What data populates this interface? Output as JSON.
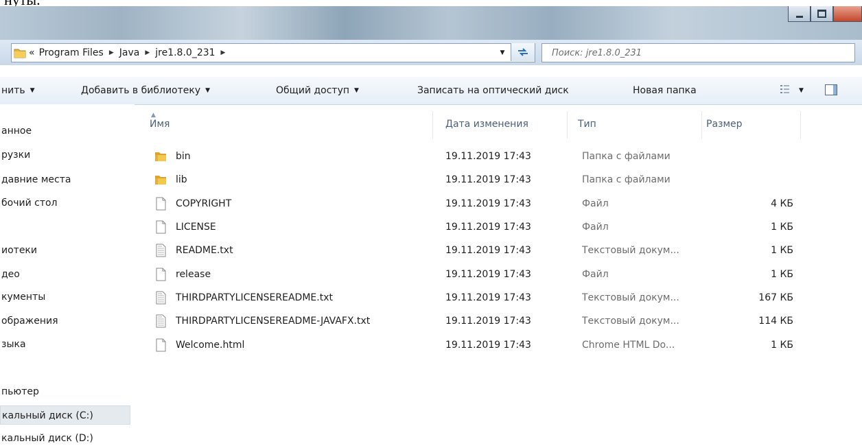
{
  "topstrip_text": "нуты.",
  "address": {
    "overflow": "«",
    "breadcrumbs": [
      "Program Files",
      "Java",
      "jre1.8.0_231"
    ],
    "search_placeholder": "Поиск: jre1.8.0_231"
  },
  "toolbar": {
    "organize": "нить",
    "add_to_library": "Добавить в библиотеку",
    "share": "Общий доступ",
    "burn": "Записать на оптический диск",
    "new_folder": "Новая папка"
  },
  "nav": [
    "анное",
    "рузки",
    "давние места",
    "бочий стол",
    "иотеки",
    "део",
    "кументы",
    "ображения",
    "зыка",
    "пьютер",
    "кальный диск (C:)",
    "кальный диск (D:)"
  ],
  "nav_selected": "кальный диск (C:)",
  "columns": {
    "name": "Имя",
    "date": "Дата изменения",
    "type": "Тип",
    "size": "Размер"
  },
  "files": [
    {
      "name": "bin",
      "date": "19.11.2019 17:43",
      "type": "Папка с файлами",
      "size": "",
      "icon": "folder-icon"
    },
    {
      "name": "lib",
      "date": "19.11.2019 17:43",
      "type": "Папка с файлами",
      "size": "",
      "icon": "folder-icon"
    },
    {
      "name": "COPYRIGHT",
      "date": "19.11.2019 17:43",
      "type": "Файл",
      "size": "4 КБ",
      "icon": "file-icon"
    },
    {
      "name": "LICENSE",
      "date": "19.11.2019 17:43",
      "type": "Файл",
      "size": "1 КБ",
      "icon": "file-icon"
    },
    {
      "name": "README.txt",
      "date": "19.11.2019 17:43",
      "type": "Текстовый докум...",
      "size": "1 КБ",
      "icon": "text-file-icon"
    },
    {
      "name": "release",
      "date": "19.11.2019 17:43",
      "type": "Файл",
      "size": "1 КБ",
      "icon": "file-icon"
    },
    {
      "name": "THIRDPARTYLICENSEREADME.txt",
      "date": "19.11.2019 17:43",
      "type": "Текстовый докум...",
      "size": "167 КБ",
      "icon": "text-file-icon"
    },
    {
      "name": "THIRDPARTYLICENSEREADME-JAVAFX.txt",
      "date": "19.11.2019 17:43",
      "type": "Текстовый докум...",
      "size": "114 КБ",
      "icon": "text-file-icon"
    },
    {
      "name": "Welcome.html",
      "date": "19.11.2019 17:43",
      "type": "Chrome HTML Do...",
      "size": "1 КБ",
      "icon": "file-icon"
    }
  ],
  "colors": {
    "folder": "#e8b83a",
    "header_text": "#4c607a",
    "selection": "#e5eaef"
  }
}
